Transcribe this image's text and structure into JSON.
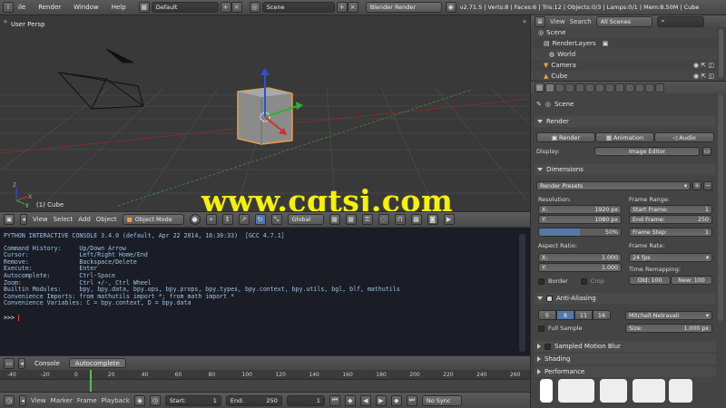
{
  "topbar": {
    "menu": [
      "ile",
      "Render",
      "Window",
      "Help"
    ],
    "layout": "Default",
    "scene": "Scene",
    "engine": "Blender Render",
    "stats": "v2.71.5 | Verts:8 | Faces:6 | Tris:12 | Objects:0/3 | Lamps:0/1 | Mem:8.50M | Cube"
  },
  "viewport": {
    "view_label": "User Persp",
    "object_label": "(1) Cube",
    "axis_x": "X",
    "axis_y": "Y",
    "axis_z": "Z"
  },
  "viewport_header": {
    "menus": [
      "View",
      "Select",
      "Add",
      "Object"
    ],
    "mode": "Object Mode",
    "orientation": "Global"
  },
  "console": {
    "header": "PYTHON INTERACTIVE CONSOLE 3.4.0 (default, Apr 22 2014, 16:30:33)  [GCC 4.7.1]",
    "lines": [
      "Command History:     Up/Down Arrow",
      "Cursor:              Left/Right Home/End",
      "Remove:              Backspace/Delete",
      "Execute:             Enter",
      "Autocomplete:        Ctrl-Space",
      "Zoom:                Ctrl +/-, Ctrl Wheel",
      "Builtin Modules:     bpy, bpy.data, bpy.ops, bpy.props, bpy.types, bpy.context, bpy.utils, bgl, blf, mathutils",
      "Convenience Imports: from mathutils import *; from math import *",
      "Convenience Variables: C = bpy.context, D = bpy.data"
    ],
    "prompt": ">>> "
  },
  "console_footer": {
    "console_label": "Console",
    "autocomplete_label": "Autocomplete"
  },
  "timeline": {
    "ticks": [
      "-40",
      "-20",
      "0",
      "20",
      "40",
      "60",
      "80",
      "100",
      "120",
      "140",
      "160",
      "180",
      "200",
      "220",
      "240",
      "260"
    ],
    "current_frame_fraction": 0.17,
    "menus": [
      "View",
      "Marker",
      "Frame",
      "Playback"
    ],
    "start_label": "Start:",
    "start_value": "1",
    "end_label": "End:",
    "end_value": "250",
    "current_frame": "1",
    "sync": "No Sync"
  },
  "outliner": {
    "menus": [
      "View",
      "Search"
    ],
    "scope": "All Scenes",
    "items": [
      {
        "label": "Scene",
        "indent": 0
      },
      {
        "label": "RenderLayers",
        "indent": 1
      },
      {
        "label": "World",
        "indent": 1
      },
      {
        "label": "Camera",
        "indent": 1
      },
      {
        "label": "Cube",
        "indent": 1
      }
    ]
  },
  "properties": {
    "context": "Scene",
    "render": {
      "title": "Render",
      "render_btn": "Render",
      "animation_btn": "Animation",
      "audio_btn": "Audio",
      "display_label": "Display:",
      "display_value": "Image Editor"
    },
    "dimensions": {
      "title": "Dimensions",
      "presets": "Render Presets",
      "resolution_label": "Resolution:",
      "res_x": "1920 px",
      "res_y": "1080 px",
      "res_pct": "50%",
      "frame_range_label": "Frame Range:",
      "start_frame": "Start Frame:",
      "start_frame_val": "1",
      "end_frame": "End Frame:",
      "end_frame_val": "250",
      "frame_step": "Frame Step:",
      "frame_step_val": "1",
      "aspect_label": "Aspect Ratio:",
      "aspect_x": "1.000",
      "aspect_y": "1.000",
      "frame_rate_label": "Frame Rate:",
      "frame_rate": "24 fps",
      "time_remap_label": "Time Remapping:",
      "old": "Old: 100",
      "new": "New: 100",
      "border": "Border",
      "crop": "Crop"
    },
    "antialiasing": {
      "title": "Anti-Aliasing",
      "samples": [
        "5",
        "8",
        "11",
        "16"
      ],
      "filter": "Mitchell-Netravali",
      "full_sample": "Full Sample",
      "size_label": "Size:",
      "size_val": "1.000 px"
    },
    "collapsed": [
      "Sampled Motion Blur",
      "Shading",
      "Performance"
    ]
  },
  "watermark": "www.cgtsj.com",
  "colors": {
    "x_axis": "#c03030",
    "y_axis": "#40a040",
    "z_axis": "#3050d0",
    "selected": "#f0a040"
  }
}
